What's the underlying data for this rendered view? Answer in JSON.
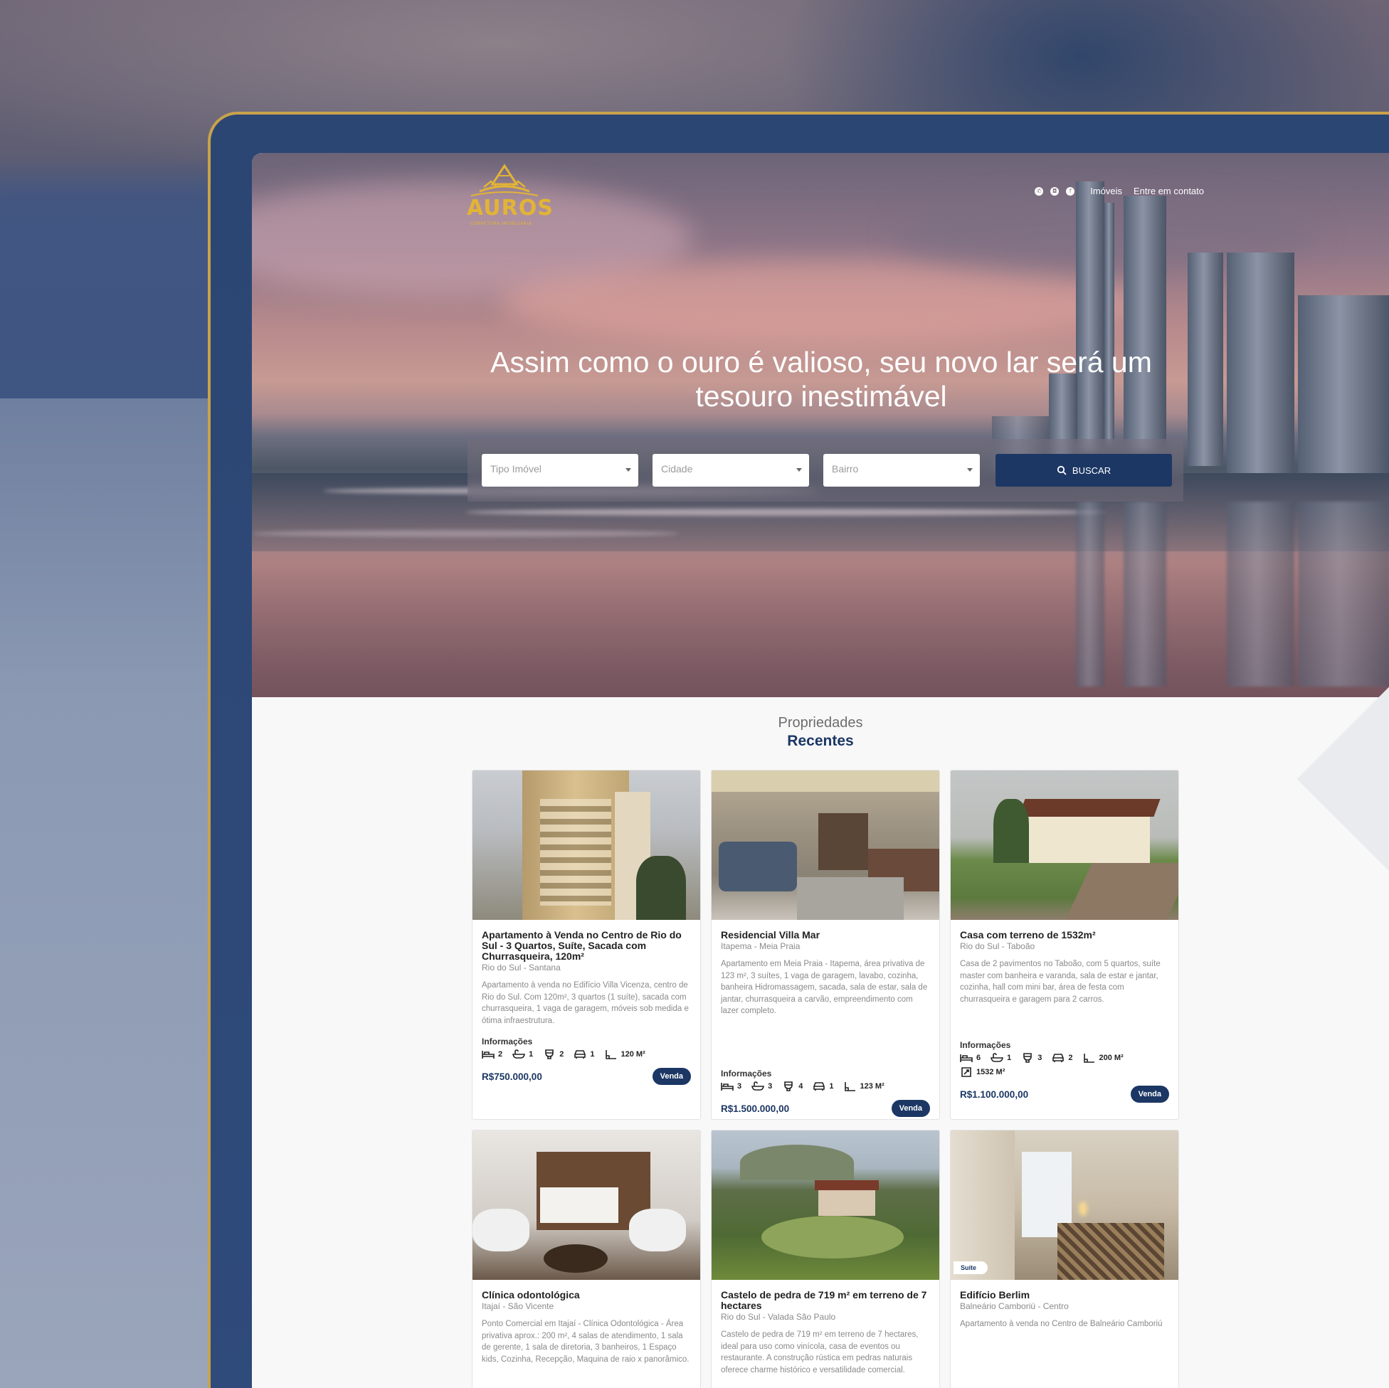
{
  "brand": {
    "name": "AUROS",
    "tagline": "CORRETORA IMOBILIÁRIA",
    "gold": "#e2b436",
    "navy": "#1c3764"
  },
  "nav": {
    "social": [
      "whatsapp-icon",
      "instagram-icon",
      "facebook-icon"
    ],
    "links": [
      "Imóveis",
      "Entre em contato"
    ]
  },
  "hero": {
    "title_line1": "Assim como o ouro é valioso, seu novo lar será um",
    "title_line2": "tesouro inestimável"
  },
  "search": {
    "fields": [
      {
        "placeholder": "Tipo Imóvel"
      },
      {
        "placeholder": "Cidade"
      },
      {
        "placeholder": "Bairro"
      }
    ],
    "button_label": "BUSCAR"
  },
  "section": {
    "title_top": "Propriedades",
    "title_bottom": "Recentes"
  },
  "cards": [
    {
      "title": "Apartamento à Venda no Centro de Rio do Sul - 3 Quartos, Suíte, Sacada com Churrasqueira, 120m²",
      "location": "Rio do Sul - Santana",
      "description": "Apartamento à venda no Edifício Villa Vicenza, centro de Rio do Sul. Com 120m², 3 quartos (1 suíte), sacada com churrasqueira, 1 vaga de garagem, móveis sob medida e ótima infraestrutura.",
      "info_label": "Informações",
      "features": {
        "bed": "2",
        "bath": "1",
        "toilet": "2",
        "car": "1",
        "area": "120 M²"
      },
      "price": "R$750.000,00",
      "tag": "Venda"
    },
    {
      "title": "Residencial Villa Mar",
      "location": "Itapema - Meia Praia",
      "description": "Apartamento em Meia Praia - Itapema, área privativa de 123 m², 3 suítes, 1 vaga de garagem, lavabo, cozinha, banheira Hidromassagem, sacada, sala de estar, sala de jantar, churrasqueira a carvão, empreendimento com lazer completo.",
      "info_label": "Informações",
      "features": {
        "bed": "3",
        "bath": "3",
        "toilet": "4",
        "car": "1",
        "area": "123 M²"
      },
      "price": "R$1.500.000,00",
      "tag": "Venda"
    },
    {
      "title": "Casa com terreno de 1532m²",
      "location": "Rio do Sul - Taboão",
      "description": "Casa de 2 pavimentos no Taboão, com 5 quartos, suíte master com banheira e varanda, sala de estar e jantar, cozinha, hall com mini bar, área de festa com churrasqueira e garagem para 2 carros.",
      "info_label": "Informações",
      "features": {
        "bed": "6",
        "bath": "1",
        "toilet": "3",
        "car": "2",
        "area": "200 M²",
        "land": "1532 M²"
      },
      "price": "R$1.100.000,00",
      "tag": "Venda"
    },
    {
      "title": "Clínica odontológica",
      "location": "Itajaí - São Vicente",
      "description": "Ponto Comercial em Itajaí - Clínica Odontológica - Área privativa aprox.: 200 m², 4 salas de atendimento, 1 sala de gerente, 1 sala de diretoria, 3 banheiros, 1 Espaço kids, Cozinha, Recepção, Maquina de raio x panorâmico."
    },
    {
      "title": "Castelo de pedra de 719 m² em terreno de 7 hectares",
      "location": "Rio do Sul - Valada São Paulo",
      "description": "Castelo de pedra de 719 m² em terreno de 7 hectares, ideal para uso como vinícola, casa de eventos ou restaurante. A construção rústica em pedras naturais oferece charme histórico e versatilidade comercial."
    },
    {
      "title": "Edifício Berlim",
      "location": "Balneário Camboriú - Centro",
      "description": "Apartamento à venda no Centro de Balneário Camboriú",
      "badge": "Suíte"
    }
  ]
}
